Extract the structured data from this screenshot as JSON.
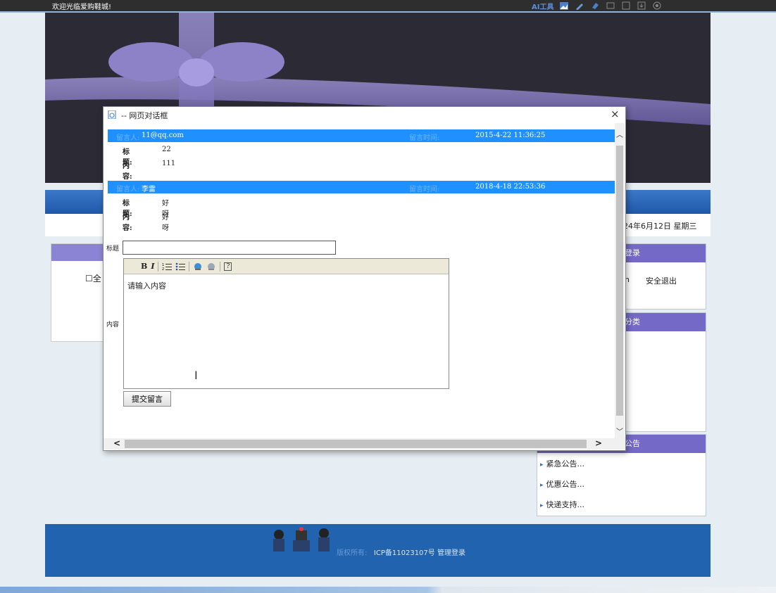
{
  "topbar": {
    "welcome": "欢迎光临爱购鞋城!",
    "ai_tool": "AI工具",
    "tool_icons": [
      "image-icon",
      "pen-icon",
      "eraser-icon",
      "crop-icon",
      "fullscreen-icon",
      "download-icon",
      "settings-icon"
    ]
  },
  "site": {
    "date": "24年6月12日 星期三",
    "left_checkbox": "☐全",
    "login_head": "登录",
    "login_user_tail": "n",
    "logout": "安全退出",
    "category_head": "分类",
    "notice_head": "公告",
    "notices": [
      "紧急公告...",
      "优惠公告...",
      "快递支持..."
    ],
    "footer_copyright": "版权所有:",
    "footer_icp": "ICP备11023107号 管理登录"
  },
  "dialog": {
    "title": "-- 网页对话框",
    "close": "×",
    "messages": [
      {
        "author_label": "留言人:",
        "author": "11@qq.com",
        "time_label": "留言时间:",
        "time": "2015-4-22 11:36:25",
        "title_label": "标题:",
        "title": "22",
        "content_label": "内容:",
        "content": "111"
      },
      {
        "author_label": "留言人:",
        "author": "李雷",
        "time_label": "留言时间:",
        "time": "2018-4-18 22:53:36",
        "title_label": "标题:",
        "title": "好呀",
        "content_label": "内容:",
        "content": "好呀"
      }
    ],
    "form": {
      "title_label": "标题",
      "title_value": "",
      "content_label": "内容",
      "editor_placeholder": "请输入内容",
      "submit": "提交留言"
    },
    "toolbar": {
      "bold": "B",
      "italic": "I",
      "help": "?"
    }
  }
}
